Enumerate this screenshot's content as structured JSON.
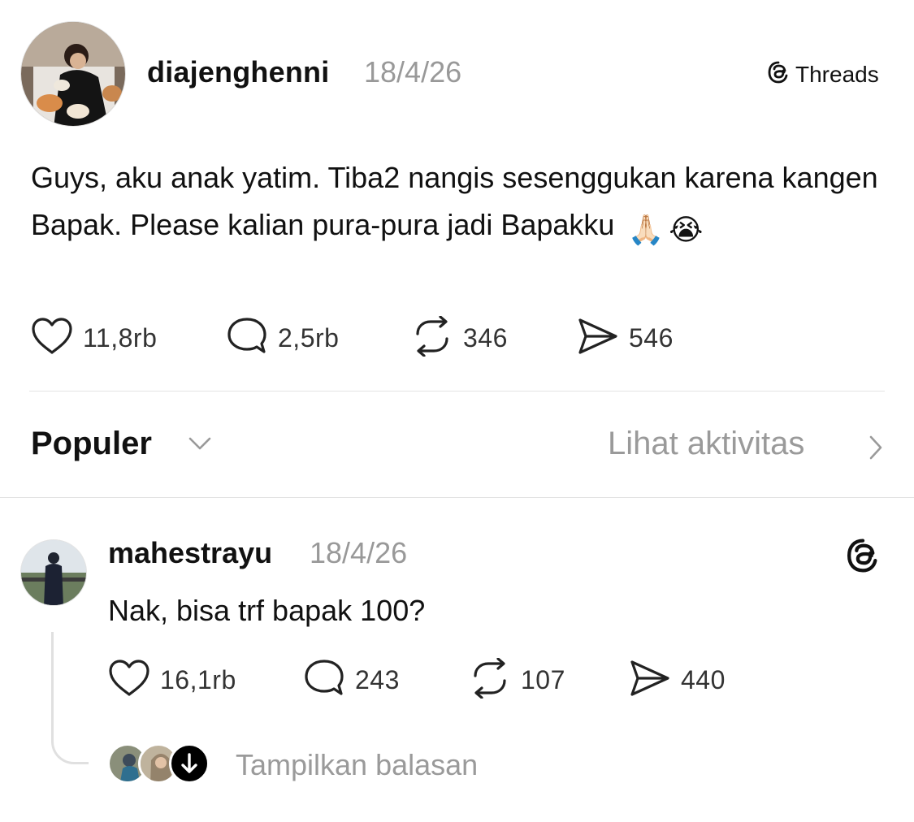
{
  "brand": {
    "label": "Threads"
  },
  "post": {
    "username": "diajenghenni",
    "date": "18/4/26",
    "text": "Guys, aku anak yatim. Tiba2 nangis sesenggukan karena kangen Bapak. Please kalian pura-pura jadi Bapakku",
    "emojis": [
      "🙏🏻",
      "😭"
    ],
    "stats": {
      "likes": "11,8rb",
      "replies": "2,5rb",
      "reposts": "346",
      "shares": "546"
    }
  },
  "sort": {
    "label": "Populer",
    "activity_link": "Lihat aktivitas"
  },
  "reply": {
    "username": "mahestrayu",
    "date": "18/4/26",
    "text": "Nak, bisa trf bapak 100?",
    "stats": {
      "likes": "16,1rb",
      "replies": "243",
      "reposts": "107",
      "shares": "440"
    },
    "show_replies": "Tampilkan balasan"
  },
  "colors": {
    "text": "#111111",
    "muted": "#9a9a9a",
    "divider": "#e3e3e3",
    "background": "#ffffff"
  },
  "icons": [
    "heart-icon",
    "comment-icon",
    "repost-icon",
    "share-icon",
    "chevron-down-icon",
    "chevron-right-icon",
    "threads-logo-icon",
    "arrow-down-icon"
  ]
}
